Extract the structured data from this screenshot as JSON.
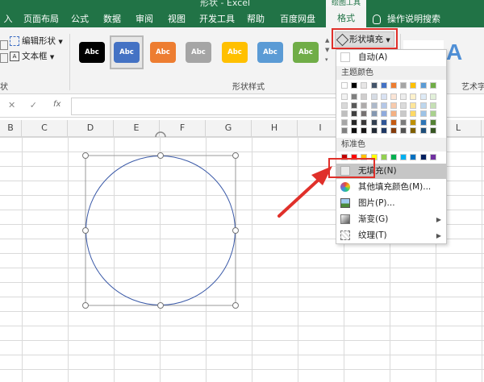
{
  "window": {
    "title": "形状 - Excel",
    "context_header": "绘图工具"
  },
  "tabs": [
    "入",
    "页面布局",
    "公式",
    "数据",
    "审阅",
    "视图",
    "开发工具",
    "帮助",
    "百度网盘"
  ],
  "active_tab": "格式",
  "help_search": "操作说明搜索",
  "ribbon": {
    "edit_shape": "编辑形状",
    "text_box": "文本框",
    "insert_group_label": "状",
    "style_group_label": "形状样式",
    "art_group_label": "艺术字",
    "wordart_sample": "A",
    "shape_fill_button": "形状填充",
    "style_thumbs": [
      {
        "label": "Abc",
        "color": "#000000"
      },
      {
        "label": "Abc",
        "color": "#4472c4"
      },
      {
        "label": "Abc",
        "color": "#ed7d31"
      },
      {
        "label": "Abc",
        "color": "#a5a5a5"
      },
      {
        "label": "Abc",
        "color": "#ffc000"
      },
      {
        "label": "Abc",
        "color": "#5b9bd5"
      },
      {
        "label": "Abc",
        "color": "#70ad47"
      }
    ]
  },
  "formula_bar": {
    "fx": "fx",
    "cancel": "✕",
    "confirm": "✓"
  },
  "columns": [
    "B",
    "C",
    "D",
    "E",
    "F",
    "G",
    "H",
    "I",
    "L"
  ],
  "dropdown": {
    "auto": "自动(A)",
    "theme_colors_label": "主题颜色",
    "standard_colors_label": "标准色",
    "no_fill": "无填充(N)",
    "more_colors": "其他填充颜色(M)...",
    "picture": "图片(P)...",
    "gradient": "渐变(G)",
    "texture": "纹理(T)",
    "theme_top": [
      "#ffffff",
      "#000000",
      "#e7e6e6",
      "#44546a",
      "#4472c4",
      "#ed7d31",
      "#a5a5a5",
      "#ffc000",
      "#5b9bd5",
      "#70ad47"
    ],
    "theme_columns": [
      [
        "#f2f2f2",
        "#d9d9d9",
        "#bfbfbf",
        "#a6a6a6",
        "#7f7f7f"
      ],
      [
        "#7f7f7f",
        "#595959",
        "#404040",
        "#262626",
        "#0d0d0d"
      ],
      [
        "#d0cece",
        "#aeabab",
        "#757171",
        "#3a3838",
        "#171616"
      ],
      [
        "#d6dce5",
        "#adb9ca",
        "#8497b0",
        "#333f50",
        "#222a35"
      ],
      [
        "#d9e2f3",
        "#b4c7e7",
        "#8faadc",
        "#2f5597",
        "#1f3864"
      ],
      [
        "#fbe5d6",
        "#f8cbad",
        "#f4b183",
        "#c55a11",
        "#843c0c"
      ],
      [
        "#ededed",
        "#dbdbdb",
        "#c9c9c9",
        "#7b7b7b",
        "#525252"
      ],
      [
        "#fff2cc",
        "#ffe699",
        "#ffd966",
        "#bf9000",
        "#7f6000"
      ],
      [
        "#deebf7",
        "#bdd7ee",
        "#9dc3e6",
        "#2e75b6",
        "#1f4e79"
      ],
      [
        "#e2f0d9",
        "#c5e0b4",
        "#a9d18e",
        "#548235",
        "#375623"
      ]
    ],
    "standard": [
      "#c00000",
      "#ff0000",
      "#ffc000",
      "#ffff00",
      "#92d050",
      "#00b050",
      "#00b0f0",
      "#0070c0",
      "#002060",
      "#7030a0"
    ]
  },
  "colors": {
    "excel_green": "#217346",
    "annotation_red": "#e0302a",
    "circle_stroke": "#3b5aa8"
  }
}
